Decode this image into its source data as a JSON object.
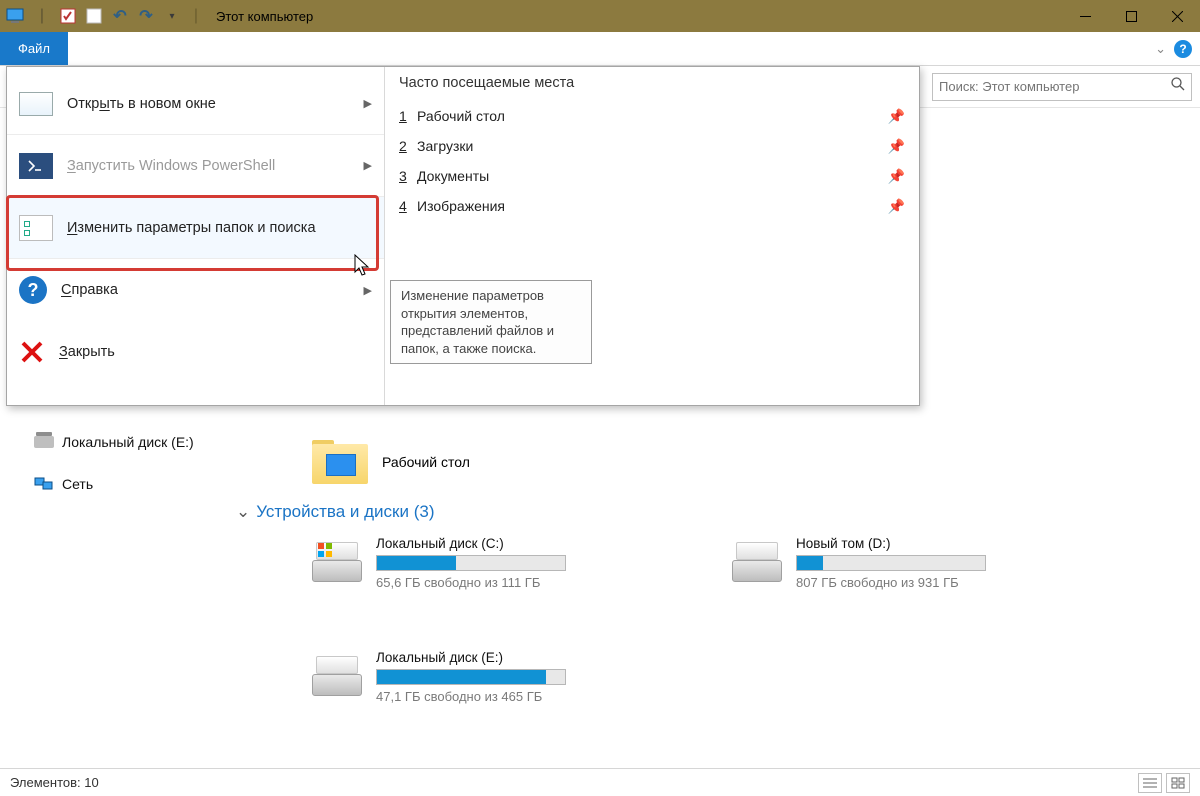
{
  "window": {
    "title": "Этот компьютер"
  },
  "ribbon": {
    "file_tab": "Файл"
  },
  "nav": {
    "search_placeholder": "Поиск: Этот компьютер"
  },
  "file_menu": {
    "open_new_window": "Открыть в новом окне",
    "run_powershell": "Запустить Windows PowerShell",
    "change_folder_search_options": "Изменить параметры папок и поиска",
    "help": "Справка",
    "close": "Закрыть",
    "right_title": "Часто посещаемые места",
    "frequent": [
      {
        "num": "1",
        "label": "Рабочий стол"
      },
      {
        "num": "2",
        "label": "Загрузки"
      },
      {
        "num": "3",
        "label": "Документы"
      },
      {
        "num": "4",
        "label": "Изображения"
      }
    ],
    "tooltip": "Изменение параметров открытия элементов, представлений файлов и папок, а также поиска."
  },
  "sidebar": {
    "local_disk_e": "Локальный диск (E:)",
    "network": "Сеть"
  },
  "main": {
    "desktop_label": "Рабочий стол",
    "section_header": "Устройства и диски (3)",
    "drives": [
      {
        "name": "Локальный диск (C:)",
        "free": "65,6 ГБ свободно из 111 ГБ",
        "fill_pct": 42,
        "os": true
      },
      {
        "name": "Новый том (D:)",
        "free": "807 ГБ свободно из 931 ГБ",
        "fill_pct": 14,
        "os": false
      },
      {
        "name": "Локальный диск (E:)",
        "free": "47,1 ГБ свободно из 465 ГБ",
        "fill_pct": 90,
        "os": false
      }
    ]
  },
  "status": {
    "elements": "Элементов: 10"
  }
}
